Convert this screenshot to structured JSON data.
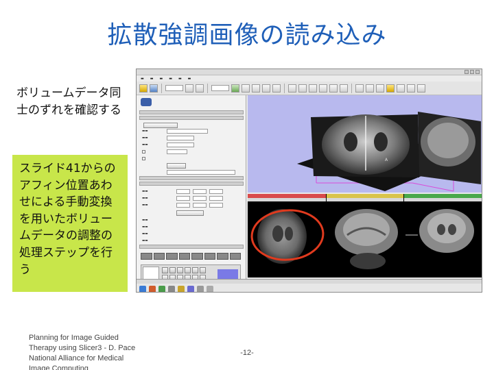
{
  "slide": {
    "title": "拡散強調画像の読み込み",
    "note_top": "ボリュームデータ同士のずれを確認する",
    "green_text": "スライド41からのアフィン位置あわせによる手動変換を用いたボリュームデータの調整の処理ステップを行う",
    "footer_left": "Planning for Image Guided Therapy using Slicer3 - D. Pace National Alliance for Medical Image Computing",
    "page_number": "-12-"
  },
  "colors": {
    "title": "#1f5fb8",
    "green_box": "#c8e64a",
    "view3d_background": "#b8b9ee",
    "highlight_ellipse": "#e03a1e",
    "slice_bar_red": "#d94a4a",
    "slice_bar_yellow": "#d9c44a",
    "slice_bar_green": "#4aa84a"
  },
  "screenshot": {
    "description_icons": [
      "slicer-logo-icon",
      "toolbar-icons",
      "volume-rendering-view",
      "axial-slice-view",
      "sagittal-slice-view",
      "coronal-slice-view"
    ]
  }
}
